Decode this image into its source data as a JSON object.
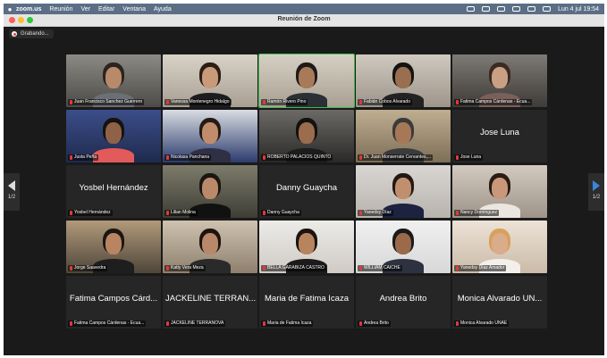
{
  "menubar": {
    "app": "zoom.us",
    "items": [
      "Reunión",
      "Ver",
      "Editar",
      "Ventana",
      "Ayuda"
    ],
    "datetime": "Lun 4 jul  19:54"
  },
  "window": {
    "title": "Reunión de Zoom"
  },
  "recording": {
    "label": "Grabando..."
  },
  "pagination": {
    "left": "1/2",
    "right": "1/2"
  },
  "participants": [
    {
      "name": "Juan Francisco Sanchez Guerrero",
      "video": true
    },
    {
      "name": "Vanessa Montenegro Hidalgo",
      "video": true
    },
    {
      "name": "Ramón Rivero Pino",
      "video": true,
      "active": true
    },
    {
      "name": "Fabián Cobos Alvarado",
      "video": true
    },
    {
      "name": "Fatima Campos Cárdenas - Ecua...",
      "video": true
    },
    {
      "name": "Justa Peña",
      "video": true
    },
    {
      "name": "Nicolasa Panchana",
      "video": true
    },
    {
      "name": "ROBERTO PALACIOS QUINTO",
      "video": true
    },
    {
      "name": "Dr. Juan Monserrate Cervantes,...",
      "video": true
    },
    {
      "name": "Jose Luna",
      "video": false,
      "display": "Jose Luna"
    },
    {
      "name": "Yosbel Hernández",
      "video": false,
      "display": "Yosbel Hernández"
    },
    {
      "name": "Lilian Molina",
      "video": true
    },
    {
      "name": "Danny Guaycha",
      "video": false,
      "display": "Danny Guaycha"
    },
    {
      "name": "Yanedsy Díaz",
      "video": true
    },
    {
      "name": "Nancy Domínguez",
      "video": true
    },
    {
      "name": "Jorge Saavedra",
      "video": true
    },
    {
      "name": "Katty Vera Meza",
      "video": true
    },
    {
      "name": "BELLA GARABIZA CASTRO",
      "video": true
    },
    {
      "name": "WILLIAM CAICHE",
      "video": true
    },
    {
      "name": "Yanedsy Díaz Amador",
      "video": true
    },
    {
      "name": "Fatima Campos Cárdenas - Ecua...",
      "video": false,
      "display": "Fatima Campos Cárd..."
    },
    {
      "name": "JACKELINE TERRANOVA",
      "video": false,
      "display": "JACKELINE TERRAN..."
    },
    {
      "name": "Maria de Fatima Icaza",
      "video": false,
      "display": "Maria de Fatima Icaza"
    },
    {
      "name": "Andrea Brito",
      "video": false,
      "display": "Andrea Brito"
    },
    {
      "name": "Monica Alvarado UNAE",
      "video": false,
      "display": "Monica Alvarado UN..."
    }
  ],
  "colors": {
    "menubar": "#5b6e86",
    "titlebar": "#e4e4e4",
    "stage": "#1a1a1a",
    "tile": "#262626",
    "active_speaker": "#3fbf4a",
    "pagination_arrow": "#3a86d6",
    "traffic_red": "#fe5f57",
    "traffic_yellow": "#febc2e",
    "traffic_green": "#28c840"
  }
}
